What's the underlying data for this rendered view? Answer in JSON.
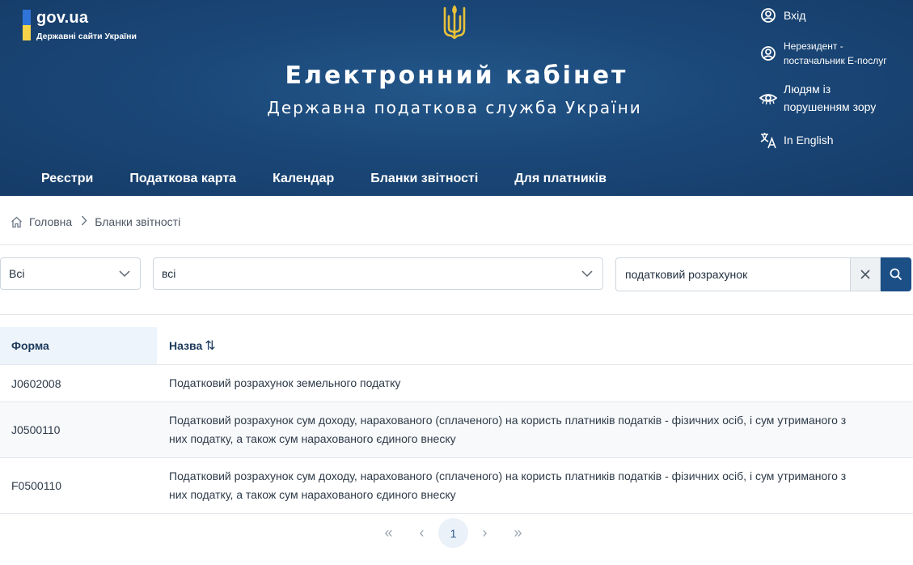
{
  "header": {
    "gov_name": "gov.ua",
    "gov_sub": "Державні сайти України",
    "title": "Електронний кабінет",
    "subtitle": "Державна податкова служба України",
    "side_links": {
      "login": "Вхід",
      "nonresident_line1": "Нерезидент -",
      "nonresident_line2": "постачальник Е-послуг",
      "vision_line1": "Людям із",
      "vision_line2": "порушенням зору",
      "english": "In English"
    },
    "nav": [
      "Реєстри",
      "Податкова карта",
      "Календар",
      "Бланки звітності",
      "Для платників"
    ]
  },
  "breadcrumb": {
    "home": "Головна",
    "current": "Бланки звітності"
  },
  "filters": {
    "select1_value": "Всі",
    "select2_value": "всі",
    "search_value": "податковий розрахунок"
  },
  "table": {
    "headers": {
      "form": "Форма",
      "name": "Назва",
      "sort_icon": "⇅"
    },
    "rows": [
      {
        "form": "J0602008",
        "name": "Податковий розрахунок земельного податку"
      },
      {
        "form": "J0500110",
        "name": "Податковий розрахунок сум доходу, нарахованого (сплаченого) на користь платників податків - фізичних осіб, і сум утриманого з них податку, а також сум нарахованого єдиного внеску"
      },
      {
        "form": "F0500110",
        "name": "Податковий розрахунок сум доходу, нарахованого (сплаченого) на користь платників податків - фізичних осіб, і сум утриманого з них податку, а також сум нарахованого єдиного внеску"
      }
    ]
  },
  "pagination": {
    "first": "«",
    "prev": "‹",
    "current": "1",
    "next": "›",
    "last": "»"
  },
  "colors": {
    "header_bg": "#1a4778",
    "accent": "#1b4f86",
    "flag_blue": "#2f74d8",
    "flag_yellow": "#f7d34a",
    "trident": "#e8c13a"
  },
  "icons": {
    "login": "user-circle-icon",
    "nonresident": "user-circle-icon",
    "vision": "eye-icon",
    "english": "translate-icon",
    "home": "home-icon",
    "chevron": "chevron-down-icon",
    "clear": "close-icon",
    "search": "search-icon"
  }
}
